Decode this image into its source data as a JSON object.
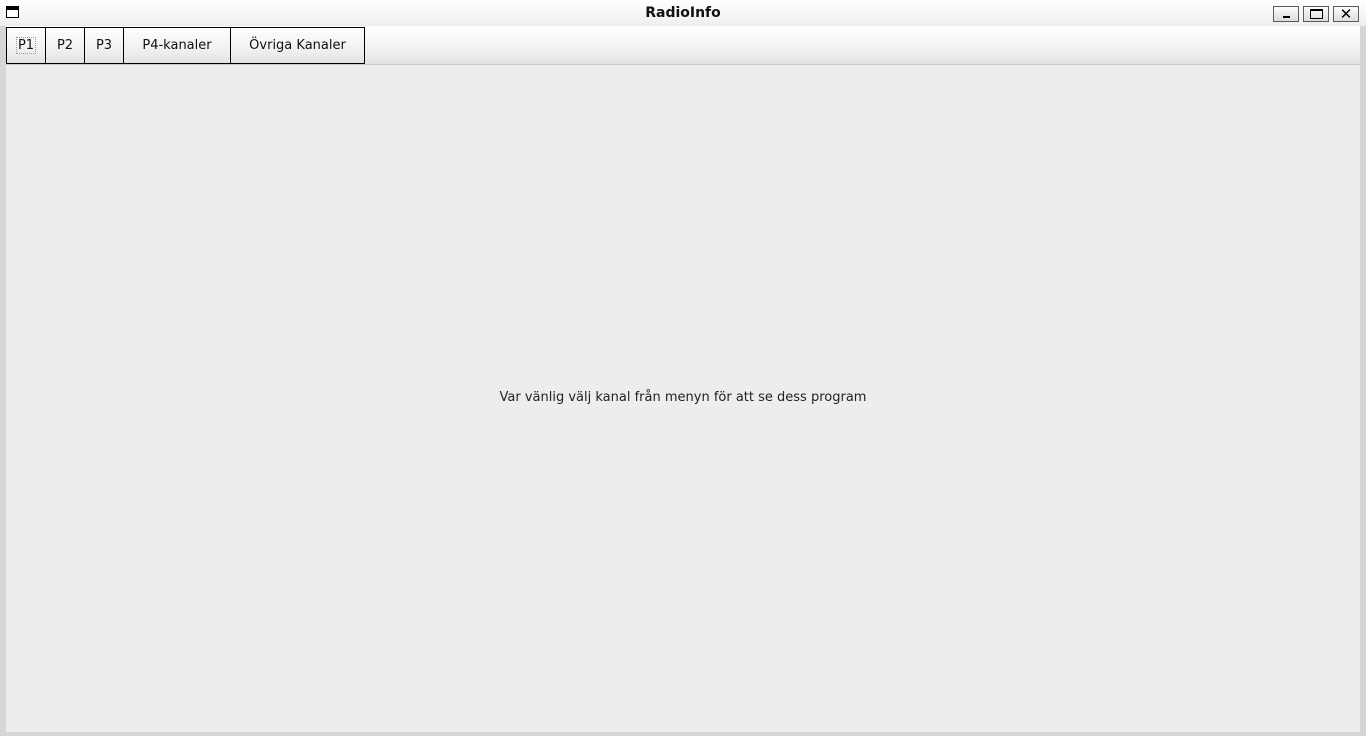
{
  "window": {
    "title": "RadioInfo"
  },
  "titlebar_buttons": {
    "minimize": "minimize",
    "maximize": "maximize",
    "close": "close"
  },
  "menubar": {
    "items": [
      {
        "label": "P1"
      },
      {
        "label": "P2"
      },
      {
        "label": "P3"
      },
      {
        "label": "P4-kanaler"
      },
      {
        "label": "Övriga Kanaler"
      }
    ]
  },
  "main": {
    "message": "Var vänlig välj kanal från menyn för att se dess program"
  },
  "colors": {
    "background": "#ededed",
    "titlebar": "#f4f4f4",
    "text": "#222222"
  }
}
